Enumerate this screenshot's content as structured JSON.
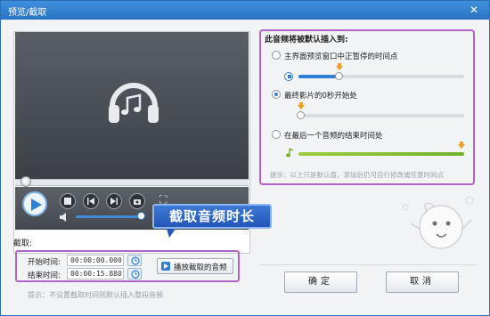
{
  "window": {
    "title": "预览/截取",
    "close_glyph": "✕"
  },
  "player": {
    "collapse_glyph": "⌄",
    "fullscreen_glyph": "⛶"
  },
  "callout": {
    "text": "截取音频时长"
  },
  "clip": {
    "heading": "截取:",
    "start_label": "开始时间:",
    "start_value": "00:00:00.000",
    "end_label": "结束时间:",
    "end_value": "00:00:15.880",
    "play_button": "播放截取的音频",
    "hint": "提示：不设置截取时间则默认插入整段音频"
  },
  "insert_panel": {
    "title": "此音频将被默认插入到:",
    "options": [
      {
        "label": "主界面预览窗口中正暂停的时间点",
        "selected": false
      },
      {
        "label": "最终影片的0秒开始处",
        "selected": true
      },
      {
        "label": "在最后一个音频的结束时间处",
        "selected": false
      }
    ],
    "hint": "提示：以上只是默认值，添加后仍可自行修改或任意时间点"
  },
  "buttons": {
    "ok": "确定",
    "cancel": "取消"
  },
  "colors": {
    "titlebar": "#2a74c4",
    "accent_blue": "#2f7fd6",
    "highlight_purple": "#b064c8",
    "marker_orange": "#f0a020",
    "green_bar": "#6fb22a"
  }
}
